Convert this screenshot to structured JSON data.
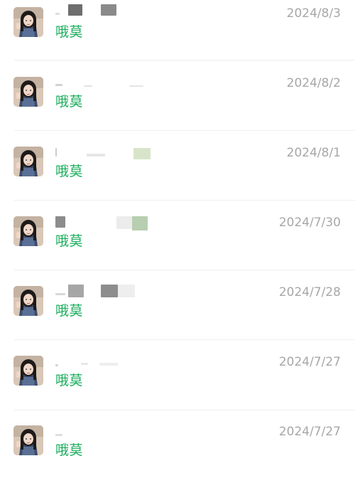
{
  "items": [
    {
      "name": "哦莫",
      "date": "2024/8/3"
    },
    {
      "name": "哦莫",
      "date": "2024/8/2"
    },
    {
      "name": "哦莫",
      "date": "2024/8/1"
    },
    {
      "name": "哦莫",
      "date": "2024/7/30"
    },
    {
      "name": "哦莫",
      "date": "2024/7/28"
    },
    {
      "name": "哦莫",
      "date": "2024/7/27"
    },
    {
      "name": "哦莫",
      "date": "2024/7/27"
    }
  ],
  "colors": {
    "name": "#1aad5b",
    "date": "#a7a7a7",
    "divider": "#efefef"
  }
}
